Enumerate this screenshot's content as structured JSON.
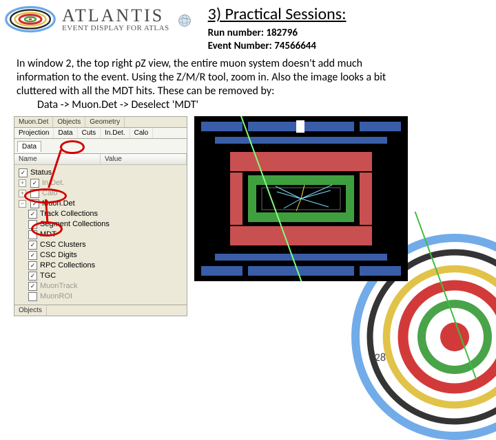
{
  "logo": {
    "main": "ATLANTIS",
    "sub": "EVENT DISPLAY FOR ATLAS"
  },
  "title": "3) Practical Sessions:",
  "meta": {
    "run": "Run number: 182796",
    "event": "Event Number: 74566644"
  },
  "body": {
    "line1": "In window 2, the top right ρZ view, the entire muon system doesn't add much",
    "line2": "information to the event. Using the  Z/M/R tool, zoom in. Also the image looks a bit",
    "line3": "cluttered with all the MDT hits. These can be removed by:",
    "line4": "Data -> Muon.Det -> Deselect 'MDT'"
  },
  "tabs": {
    "row1": [
      "Muon.Det",
      "Objects",
      "Geometry"
    ],
    "row2": [
      "Projection",
      "Data",
      "Cuts",
      "In.Det.",
      "Calo"
    ],
    "row3": "Data"
  },
  "cols": {
    "name": "Name",
    "value": "Value"
  },
  "tree": {
    "status": "Status",
    "indet": "In.Det.",
    "calo": "Calo",
    "muon": "Muon.Det",
    "trackcol": "Track Collections",
    "segcol": "Segment Collections",
    "mdt": "MDT",
    "cscclusters": "CSC Clusters",
    "cscdigits": "CSC Digits",
    "rpc": "RPC Collections",
    "tgc": "TGC",
    "muontrack": "MuonTrack",
    "muonroi": "MuonROI"
  },
  "objects_tab": "Objects",
  "page": "28"
}
